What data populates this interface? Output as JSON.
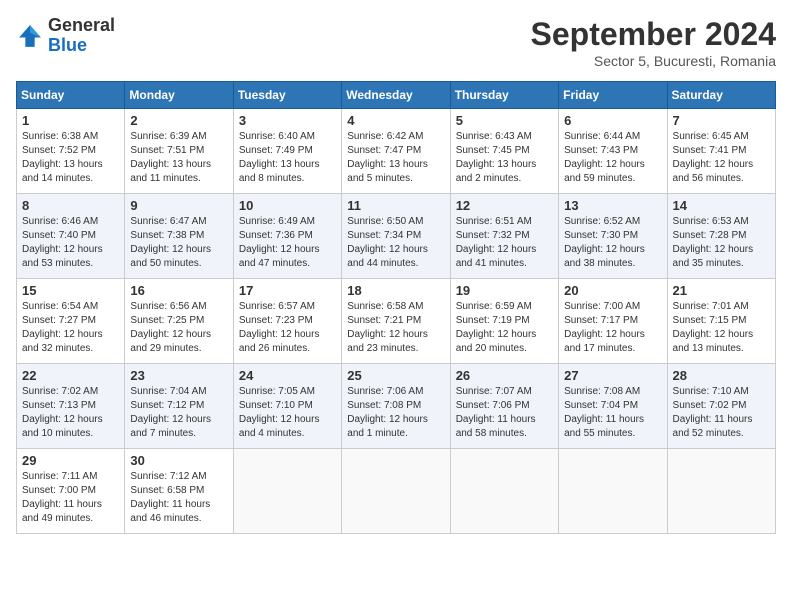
{
  "header": {
    "logo_line1": "General",
    "logo_line2": "Blue",
    "month": "September 2024",
    "location": "Sector 5, Bucuresti, Romania"
  },
  "weekdays": [
    "Sunday",
    "Monday",
    "Tuesday",
    "Wednesday",
    "Thursday",
    "Friday",
    "Saturday"
  ],
  "weeks": [
    [
      {
        "day": "1",
        "sunrise": "6:38 AM",
        "sunset": "7:52 PM",
        "daylight": "13 hours and 14 minutes."
      },
      {
        "day": "2",
        "sunrise": "6:39 AM",
        "sunset": "7:51 PM",
        "daylight": "13 hours and 11 minutes."
      },
      {
        "day": "3",
        "sunrise": "6:40 AM",
        "sunset": "7:49 PM",
        "daylight": "13 hours and 8 minutes."
      },
      {
        "day": "4",
        "sunrise": "6:42 AM",
        "sunset": "7:47 PM",
        "daylight": "13 hours and 5 minutes."
      },
      {
        "day": "5",
        "sunrise": "6:43 AM",
        "sunset": "7:45 PM",
        "daylight": "13 hours and 2 minutes."
      },
      {
        "day": "6",
        "sunrise": "6:44 AM",
        "sunset": "7:43 PM",
        "daylight": "12 hours and 59 minutes."
      },
      {
        "day": "7",
        "sunrise": "6:45 AM",
        "sunset": "7:41 PM",
        "daylight": "12 hours and 56 minutes."
      }
    ],
    [
      {
        "day": "8",
        "sunrise": "6:46 AM",
        "sunset": "7:40 PM",
        "daylight": "12 hours and 53 minutes."
      },
      {
        "day": "9",
        "sunrise": "6:47 AM",
        "sunset": "7:38 PM",
        "daylight": "12 hours and 50 minutes."
      },
      {
        "day": "10",
        "sunrise": "6:49 AM",
        "sunset": "7:36 PM",
        "daylight": "12 hours and 47 minutes."
      },
      {
        "day": "11",
        "sunrise": "6:50 AM",
        "sunset": "7:34 PM",
        "daylight": "12 hours and 44 minutes."
      },
      {
        "day": "12",
        "sunrise": "6:51 AM",
        "sunset": "7:32 PM",
        "daylight": "12 hours and 41 minutes."
      },
      {
        "day": "13",
        "sunrise": "6:52 AM",
        "sunset": "7:30 PM",
        "daylight": "12 hours and 38 minutes."
      },
      {
        "day": "14",
        "sunrise": "6:53 AM",
        "sunset": "7:28 PM",
        "daylight": "12 hours and 35 minutes."
      }
    ],
    [
      {
        "day": "15",
        "sunrise": "6:54 AM",
        "sunset": "7:27 PM",
        "daylight": "12 hours and 32 minutes."
      },
      {
        "day": "16",
        "sunrise": "6:56 AM",
        "sunset": "7:25 PM",
        "daylight": "12 hours and 29 minutes."
      },
      {
        "day": "17",
        "sunrise": "6:57 AM",
        "sunset": "7:23 PM",
        "daylight": "12 hours and 26 minutes."
      },
      {
        "day": "18",
        "sunrise": "6:58 AM",
        "sunset": "7:21 PM",
        "daylight": "12 hours and 23 minutes."
      },
      {
        "day": "19",
        "sunrise": "6:59 AM",
        "sunset": "7:19 PM",
        "daylight": "12 hours and 20 minutes."
      },
      {
        "day": "20",
        "sunrise": "7:00 AM",
        "sunset": "7:17 PM",
        "daylight": "12 hours and 17 minutes."
      },
      {
        "day": "21",
        "sunrise": "7:01 AM",
        "sunset": "7:15 PM",
        "daylight": "12 hours and 13 minutes."
      }
    ],
    [
      {
        "day": "22",
        "sunrise": "7:02 AM",
        "sunset": "7:13 PM",
        "daylight": "12 hours and 10 minutes."
      },
      {
        "day": "23",
        "sunrise": "7:04 AM",
        "sunset": "7:12 PM",
        "daylight": "12 hours and 7 minutes."
      },
      {
        "day": "24",
        "sunrise": "7:05 AM",
        "sunset": "7:10 PM",
        "daylight": "12 hours and 4 minutes."
      },
      {
        "day": "25",
        "sunrise": "7:06 AM",
        "sunset": "7:08 PM",
        "daylight": "12 hours and 1 minute."
      },
      {
        "day": "26",
        "sunrise": "7:07 AM",
        "sunset": "7:06 PM",
        "daylight": "11 hours and 58 minutes."
      },
      {
        "day": "27",
        "sunrise": "7:08 AM",
        "sunset": "7:04 PM",
        "daylight": "11 hours and 55 minutes."
      },
      {
        "day": "28",
        "sunrise": "7:10 AM",
        "sunset": "7:02 PM",
        "daylight": "11 hours and 52 minutes."
      }
    ],
    [
      {
        "day": "29",
        "sunrise": "7:11 AM",
        "sunset": "7:00 PM",
        "daylight": "11 hours and 49 minutes."
      },
      {
        "day": "30",
        "sunrise": "7:12 AM",
        "sunset": "6:58 PM",
        "daylight": "11 hours and 46 minutes."
      },
      null,
      null,
      null,
      null,
      null
    ]
  ]
}
